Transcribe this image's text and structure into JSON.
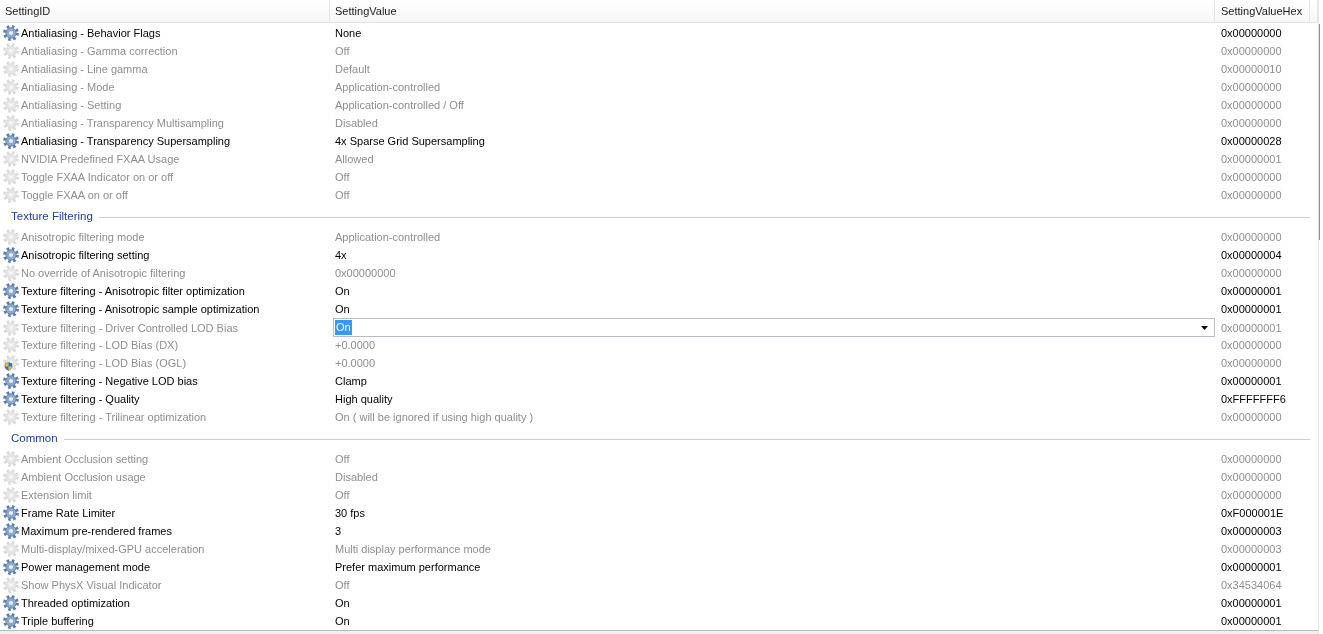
{
  "columns": [
    {
      "label": "SettingID"
    },
    {
      "label": "SettingValue"
    },
    {
      "label": "SettingValueHex"
    }
  ],
  "groups": [
    {
      "rows": [
        {
          "name": "Antialiasing - Behavior Flags",
          "value": "None",
          "hex": "0x00000000",
          "kind": "user",
          "editing": false
        },
        {
          "name": "Antialiasing - Gamma correction",
          "value": "Off",
          "hex": "0x00000000",
          "kind": "default",
          "editing": false
        },
        {
          "name": "Antialiasing - Line gamma",
          "value": "Default",
          "hex": "0x00000010",
          "kind": "default",
          "editing": false
        },
        {
          "name": "Antialiasing - Mode",
          "value": "Application-controlled",
          "hex": "0x00000000",
          "kind": "default",
          "editing": false
        },
        {
          "name": "Antialiasing - Setting",
          "value": "Application-controlled / Off",
          "hex": "0x00000000",
          "kind": "default",
          "editing": false
        },
        {
          "name": "Antialiasing - Transparency Multisampling",
          "value": "Disabled",
          "hex": "0x00000000",
          "kind": "default",
          "editing": false
        },
        {
          "name": "Antialiasing - Transparency Supersampling",
          "value": "4x Sparse Grid Supersampling",
          "hex": "0x00000028",
          "kind": "user",
          "editing": false
        },
        {
          "name": "NVIDIA Predefined FXAA Usage",
          "value": "Allowed",
          "hex": "0x00000001",
          "kind": "default",
          "editing": false
        },
        {
          "name": "Toggle FXAA Indicator on or off",
          "value": "Off",
          "hex": "0x00000000",
          "kind": "default",
          "editing": false
        },
        {
          "name": "Toggle FXAA on or off",
          "value": "Off",
          "hex": "0x00000000",
          "kind": "default",
          "editing": false
        }
      ]
    },
    {
      "title": "Texture Filtering",
      "rows": [
        {
          "name": "Anisotropic filtering mode",
          "value": "Application-controlled",
          "hex": "0x00000000",
          "kind": "default",
          "editing": false
        },
        {
          "name": "Anisotropic filtering setting",
          "value": "4x",
          "hex": "0x00000004",
          "kind": "user",
          "editing": false
        },
        {
          "name": "No override of Anisotropic filtering",
          "value": "0x00000000",
          "hex": "0x00000000",
          "kind": "default",
          "editing": false
        },
        {
          "name": "Texture filtering - Anisotropic filter optimization",
          "value": "On",
          "hex": "0x00000001",
          "kind": "user",
          "editing": false
        },
        {
          "name": "Texture filtering - Anisotropic sample optimization",
          "value": "On",
          "hex": "0x00000001",
          "kind": "user",
          "editing": false
        },
        {
          "name": "Texture filtering - Driver Controlled LOD Bias",
          "value": "On",
          "hex": "0x00000001",
          "kind": "default",
          "editing": true
        },
        {
          "name": "Texture filtering - LOD Bias (DX)",
          "value": "+0.0000",
          "hex": "0x00000000",
          "kind": "default",
          "editing": false
        },
        {
          "name": "Texture filtering - LOD Bias (OGL)",
          "value": "+0.0000",
          "hex": "0x00000000",
          "kind": "shield",
          "editing": false
        },
        {
          "name": "Texture filtering - Negative LOD bias",
          "value": "Clamp",
          "hex": "0x00000001",
          "kind": "user",
          "editing": false
        },
        {
          "name": "Texture filtering - Quality",
          "value": "High quality",
          "hex": "0xFFFFFFF6",
          "kind": "user",
          "editing": false
        },
        {
          "name": "Texture filtering - Trilinear optimization",
          "value": "On ( will be ignored if using high quality )",
          "hex": "0x00000000",
          "kind": "default",
          "editing": false
        }
      ]
    },
    {
      "title": "Common",
      "rows": [
        {
          "name": "Ambient Occlusion setting",
          "value": "Off",
          "hex": "0x00000000",
          "kind": "default",
          "editing": false
        },
        {
          "name": "Ambient Occlusion usage",
          "value": "Disabled",
          "hex": "0x00000000",
          "kind": "default",
          "editing": false
        },
        {
          "name": "Extension limit",
          "value": "Off",
          "hex": "0x00000000",
          "kind": "default",
          "editing": false
        },
        {
          "name": "Frame Rate Limiter",
          "value": "30 fps",
          "hex": "0xF000001E",
          "kind": "user",
          "editing": false
        },
        {
          "name": "Maximum pre-rendered frames",
          "value": "3",
          "hex": "0x00000003",
          "kind": "user",
          "editing": false
        },
        {
          "name": "Multi-display/mixed-GPU acceleration",
          "value": "Multi display performance mode",
          "hex": "0x00000003",
          "kind": "default",
          "editing": false
        },
        {
          "name": "Power management mode",
          "value": "Prefer maximum performance",
          "hex": "0x00000001",
          "kind": "user",
          "editing": false
        },
        {
          "name": "Show PhysX Visual Indicator",
          "value": "Off",
          "hex": "0x34534064",
          "kind": "default",
          "editing": false
        },
        {
          "name": "Threaded optimization",
          "value": "On",
          "hex": "0x00000001",
          "kind": "user",
          "editing": false
        },
        {
          "name": "Triple buffering",
          "value": "On",
          "hex": "0x00000001",
          "kind": "user",
          "editing": false
        }
      ]
    }
  ]
}
